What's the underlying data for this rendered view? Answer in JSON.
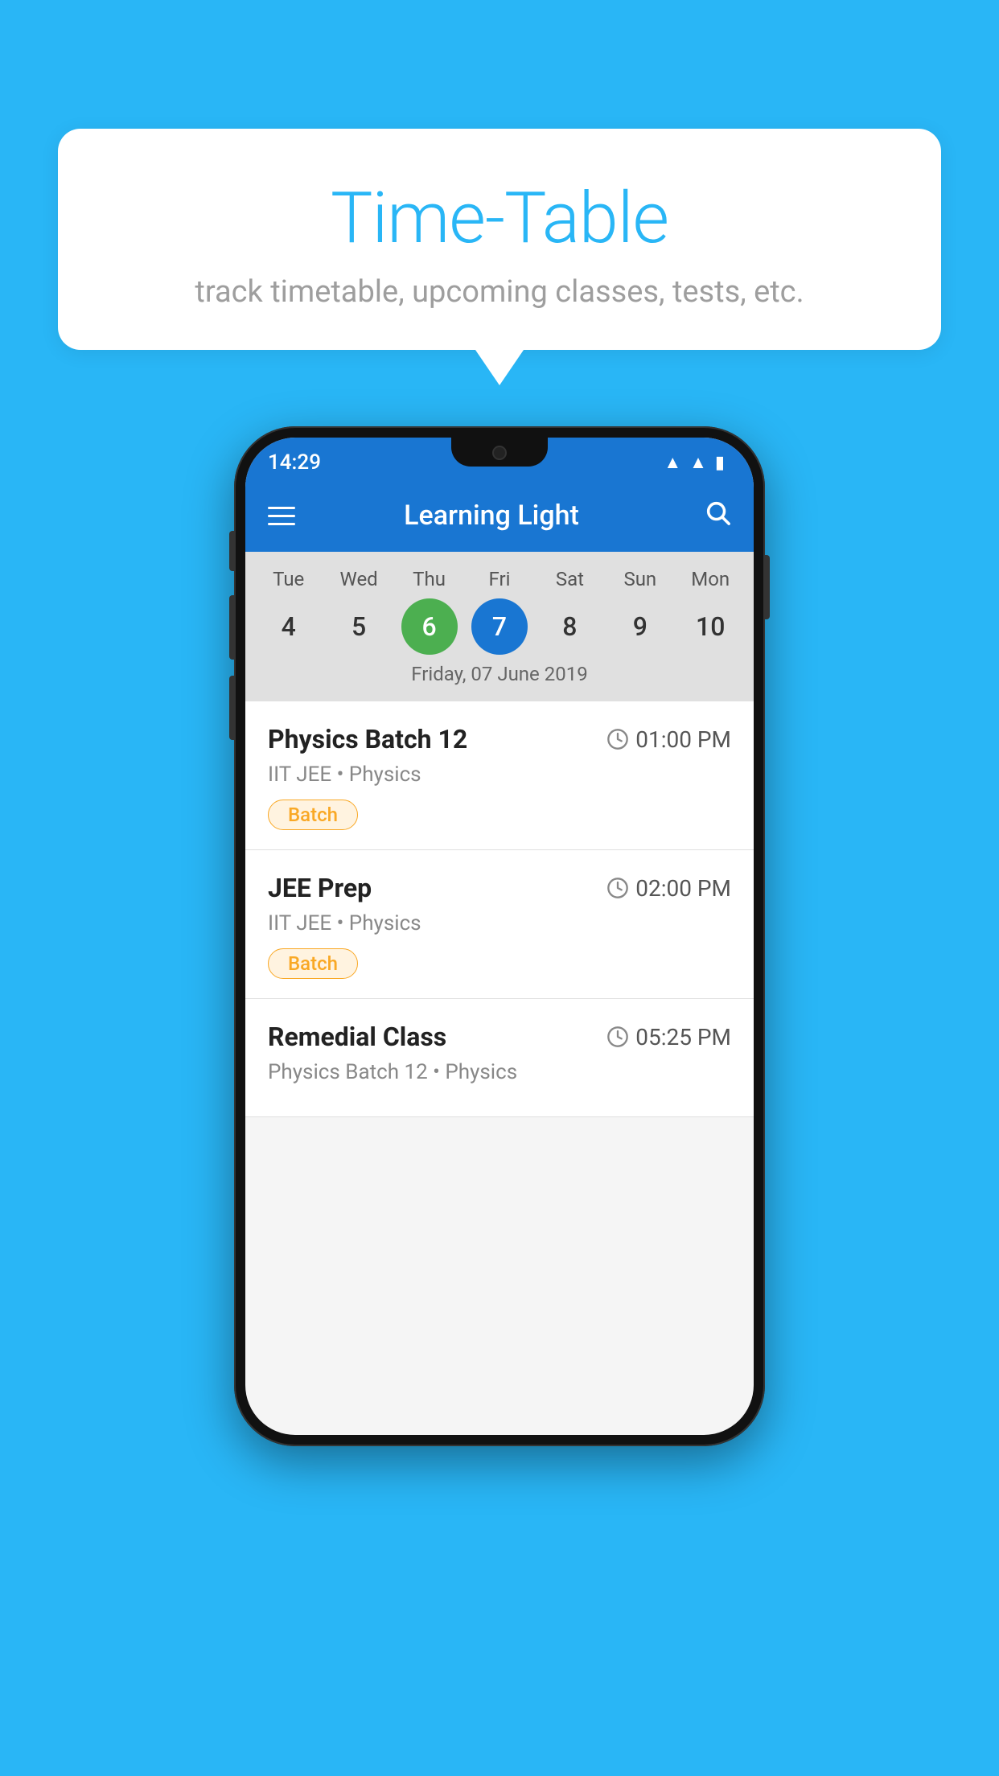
{
  "background_color": "#29B6F6",
  "bubble": {
    "title": "Time-Table",
    "subtitle": "track timetable, upcoming classes, tests, etc."
  },
  "app": {
    "name": "Learning Light",
    "status_time": "14:29"
  },
  "calendar": {
    "selected_date_label": "Friday, 07 June 2019",
    "days": [
      {
        "label": "Tue",
        "number": "4",
        "state": "normal"
      },
      {
        "label": "Wed",
        "number": "5",
        "state": "normal"
      },
      {
        "label": "Thu",
        "number": "6",
        "state": "today"
      },
      {
        "label": "Fri",
        "number": "7",
        "state": "selected"
      },
      {
        "label": "Sat",
        "number": "8",
        "state": "normal"
      },
      {
        "label": "Sun",
        "number": "9",
        "state": "normal"
      },
      {
        "label": "Mon",
        "number": "10",
        "state": "normal"
      }
    ]
  },
  "schedule": {
    "items": [
      {
        "title": "Physics Batch 12",
        "time": "01:00 PM",
        "subtitle": "IIT JEE • Physics",
        "badge": "Batch"
      },
      {
        "title": "JEE Prep",
        "time": "02:00 PM",
        "subtitle": "IIT JEE • Physics",
        "badge": "Batch"
      },
      {
        "title": "Remedial Class",
        "time": "05:25 PM",
        "subtitle": "Physics Batch 12 • Physics",
        "badge": null
      }
    ]
  },
  "icons": {
    "hamburger": "☰",
    "search": "🔍",
    "clock": "🕐"
  }
}
